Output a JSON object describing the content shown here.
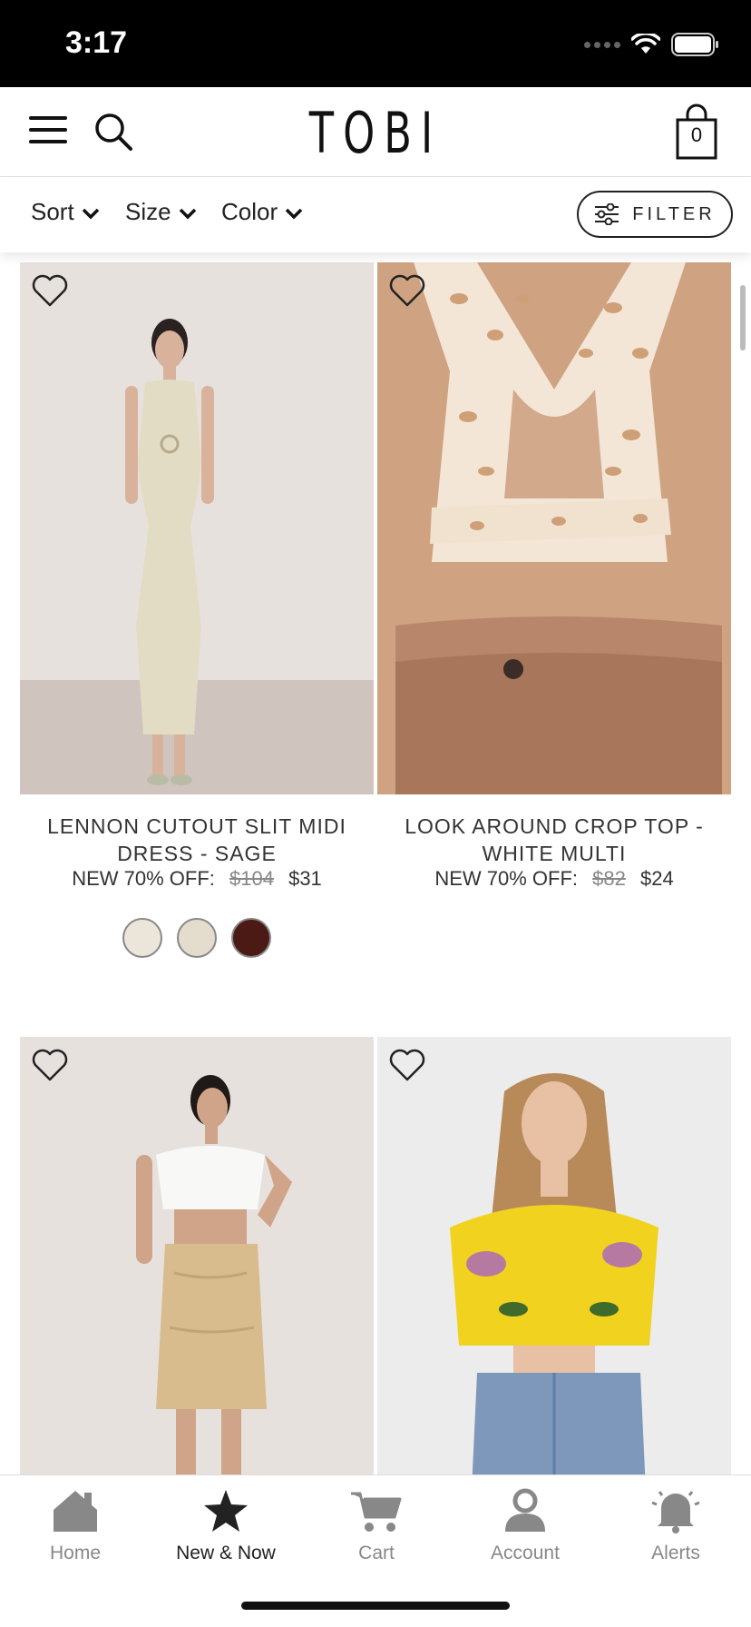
{
  "status_bar": {
    "time": "3:17"
  },
  "header": {
    "logo": "TOBI",
    "cart_count": "0"
  },
  "filters": {
    "sort_label": "Sort",
    "size_label": "Size",
    "color_label": "Color",
    "filter_label": "FILTER"
  },
  "products": [
    {
      "name": "LENNON CUTOUT SLIT MIDI DRESS - SAGE",
      "price_label": "NEW 70% OFF:",
      "old_price": "$104",
      "price": "$31",
      "swatches": [
        "#ece6da",
        "#e4dccd",
        "#4b1a14"
      ]
    },
    {
      "name": "LOOK AROUND CROP TOP - WHITE MULTI",
      "price_label": "NEW 70% OFF:",
      "old_price": "$82",
      "price": "$24",
      "swatches": []
    },
    {
      "name": "",
      "price_label": "",
      "old_price": "",
      "price": "",
      "swatches": []
    },
    {
      "name": "",
      "price_label": "",
      "old_price": "",
      "price": "",
      "swatches": []
    }
  ],
  "tab_bar": {
    "items": [
      {
        "label": "Home",
        "icon": "home-icon",
        "active": false
      },
      {
        "label": "New & Now",
        "icon": "star-icon",
        "active": true
      },
      {
        "label": "Cart",
        "icon": "cart-icon",
        "active": false
      },
      {
        "label": "Account",
        "icon": "account-icon",
        "active": false
      },
      {
        "label": "Alerts",
        "icon": "bell-icon",
        "active": false
      }
    ]
  },
  "colors": {
    "accent": "#222222",
    "tab_inactive": "#888888",
    "status_bar": "#000000"
  }
}
